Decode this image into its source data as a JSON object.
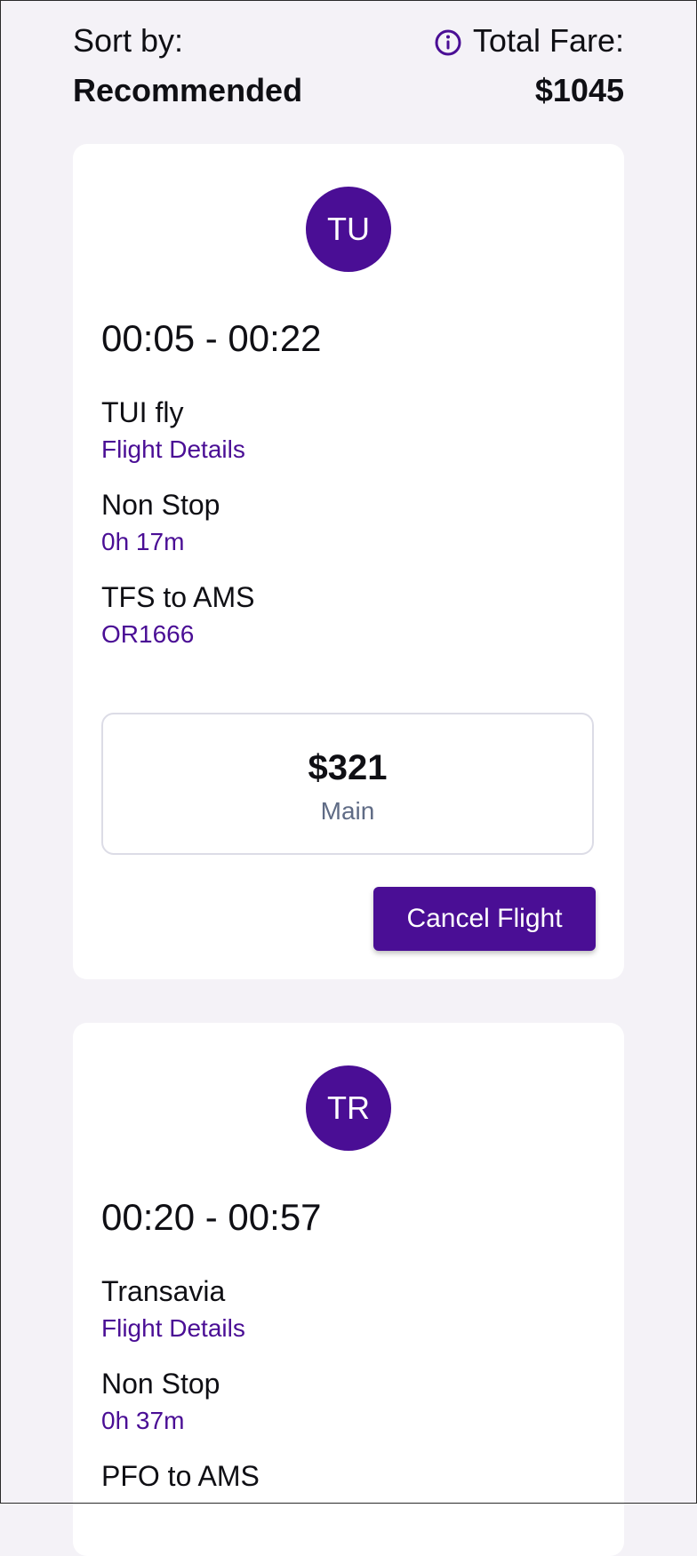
{
  "summary": {
    "sort_label": "Sort by:",
    "sort_value": "Recommended",
    "fare_label": "Total Fare:",
    "fare_value": "$1045",
    "info_icon": "info-circle-icon"
  },
  "colors": {
    "accent": "#4a0e95",
    "background": "#f4f2f7",
    "card": "#ffffff",
    "muted": "#5f6b85"
  },
  "flights": [
    {
      "avatar": "TU",
      "time": "00:05 - 00:22",
      "airline": "TUI fly",
      "details_link": "Flight Details",
      "stops": "Non Stop",
      "duration": "0h 17m",
      "route": "TFS to AMS",
      "flight_number": "OR1666",
      "price": "$321",
      "cabin": "Main",
      "cancel_label": "Cancel Flight"
    },
    {
      "avatar": "TR",
      "time": "00:20 - 00:57",
      "airline": "Transavia",
      "details_link": "Flight Details",
      "stops": "Non Stop",
      "duration": "0h 37m",
      "route": "PFO to AMS"
    }
  ]
}
